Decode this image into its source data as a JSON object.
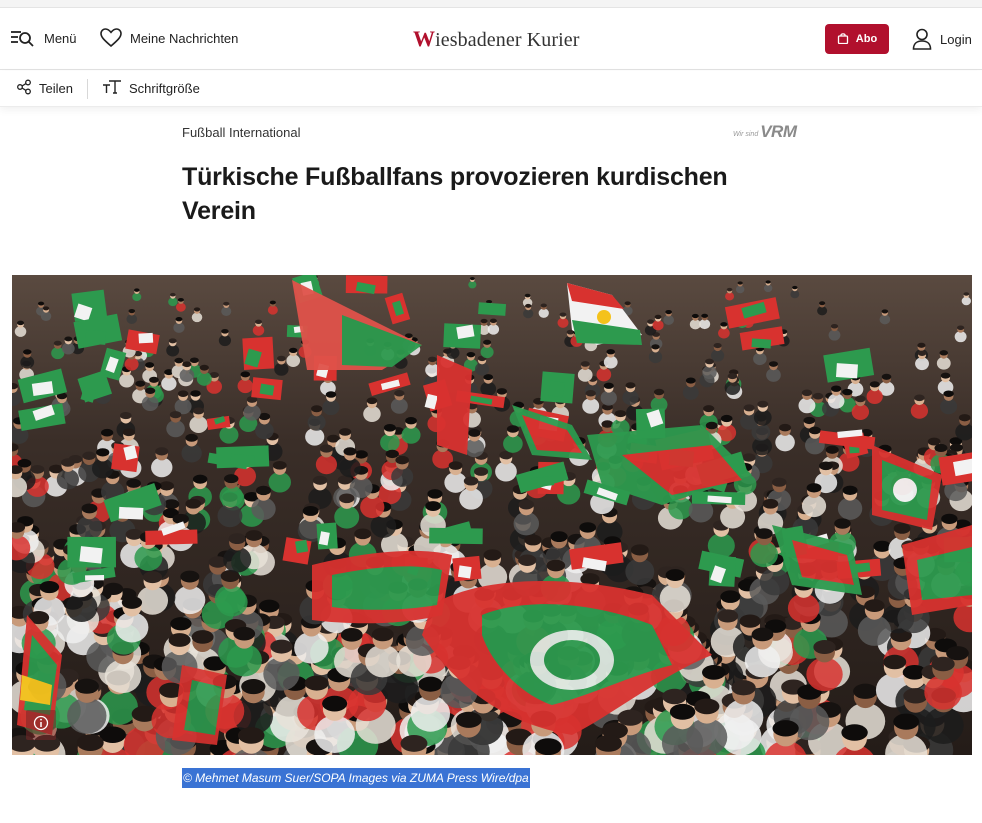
{
  "header": {
    "menu_label": "Menü",
    "favorites_label": "Meine Nachrichten",
    "logo_initial": "W",
    "logo_rest": "iesbadener Kurier",
    "abo_label": "Abo",
    "login_label": "Login"
  },
  "toolbar": {
    "share_label": "Teilen",
    "fontsize_label": "Schriftgröße"
  },
  "article": {
    "rubric": "Fußball International",
    "vrm_small": "Wir sind",
    "vrm_big": "VRM",
    "headline": "Türkische Fußballfans provozieren kurdischen Verein",
    "photo_caption": "© Mehmet Masum Suer/SOPA Images via ZUMA Press Wire/dpa"
  },
  "colors": {
    "brand": "#b1102d",
    "caption_highlight": "#3a73d4",
    "flag_red": "#d8322f",
    "flag_green": "#2d9a4e",
    "flag_white": "#ffffff"
  },
  "icons": {
    "menu": "menu-search-icon",
    "favorites": "heart-icon",
    "abo": "shopping-bag-icon",
    "login": "user-icon",
    "share": "share-icon",
    "fontsize": "font-size-icon",
    "info": "info-icon"
  }
}
